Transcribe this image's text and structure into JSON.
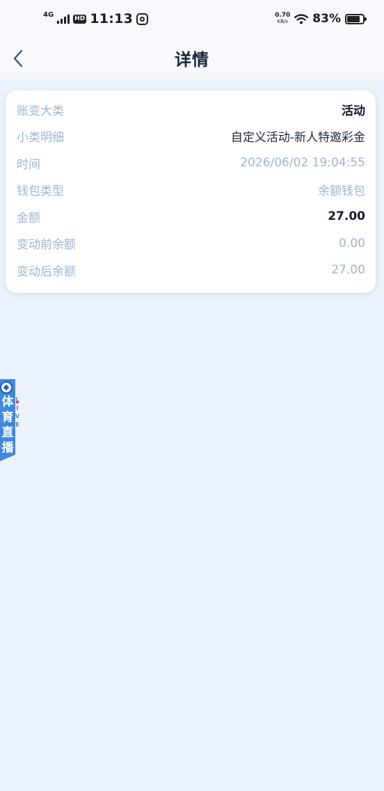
{
  "status_bar": {
    "network": "4G",
    "hd": "HD",
    "time": "11:13",
    "speed_value": "0.70",
    "speed_unit": "KB/s",
    "battery": "83%"
  },
  "nav": {
    "title": "详情"
  },
  "details": [
    {
      "label": "账变大类",
      "value": "活动"
    },
    {
      "label": "小类明细",
      "value": "自定义活动-新人特邀彩金"
    },
    {
      "label": "时间",
      "value": "2026/06/02 19:04:55"
    },
    {
      "label": "钱包类型",
      "value": "余额钱包"
    },
    {
      "label": "金额",
      "value": "27.00"
    },
    {
      "label": "变动前余额",
      "value": "0.00"
    },
    {
      "label": "变动后余额",
      "value": "27.00"
    }
  ],
  "live_widget": {
    "text": "体育直播",
    "tag": "LIVE"
  },
  "colors": {
    "background": "#ecf3fc",
    "label": "#9eb3d2",
    "value_strong": "#121a2b",
    "live_blue": "#3d8ae0"
  }
}
